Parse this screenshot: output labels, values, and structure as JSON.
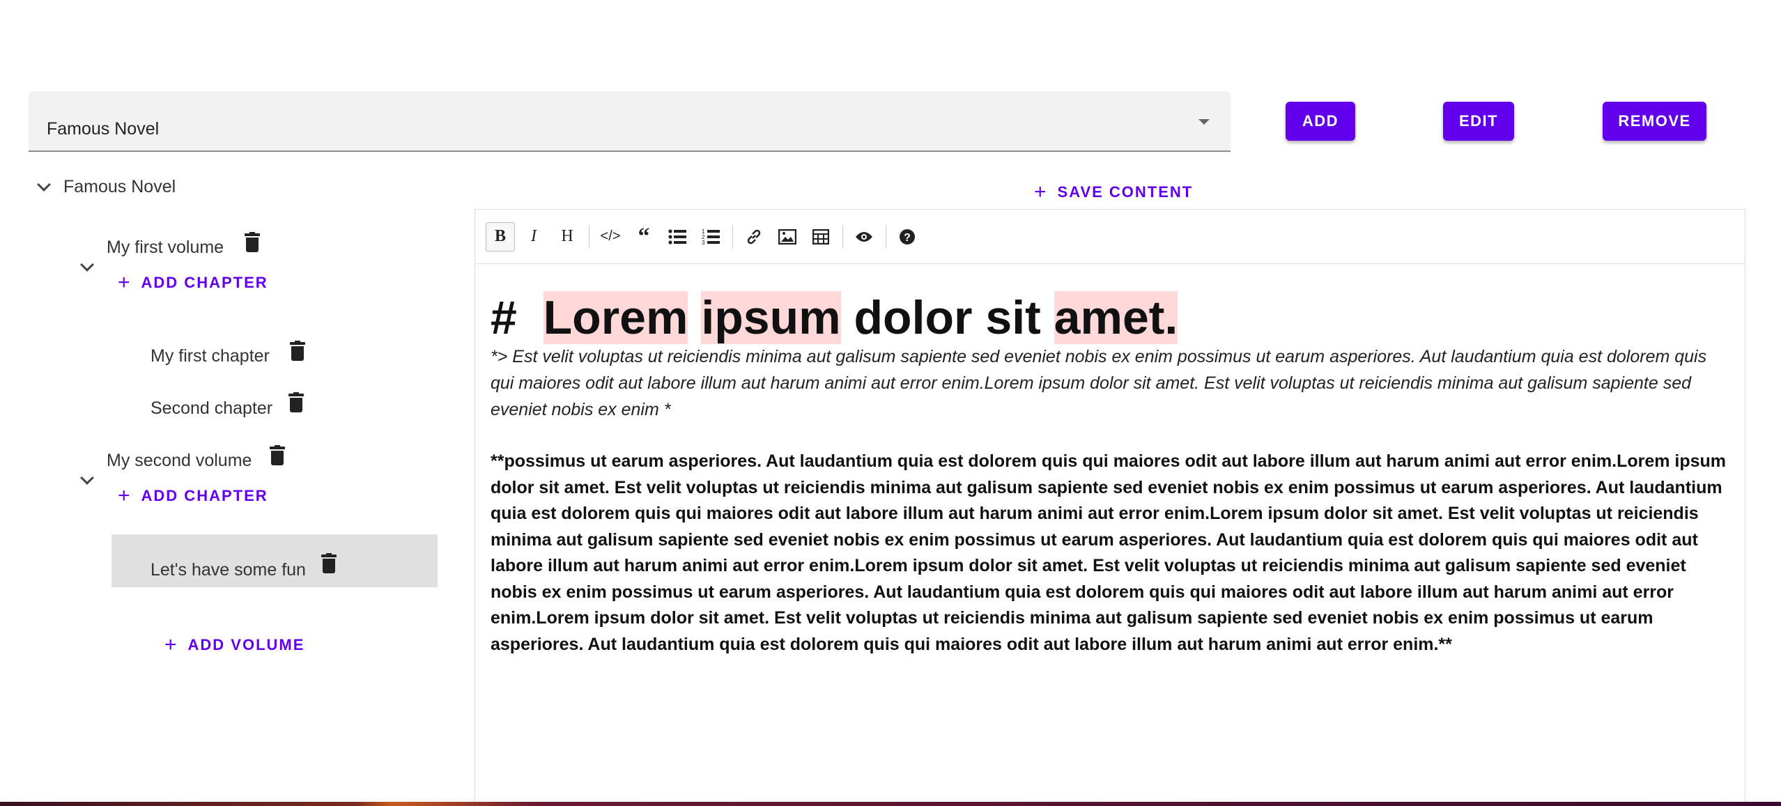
{
  "selector": {
    "value": "Famous Novel"
  },
  "buttons": {
    "add": "ADD",
    "edit": "EDIT",
    "remove": "REMOVE",
    "save_content": "SAVE CONTENT",
    "add_volume": "ADD VOLUME"
  },
  "tree": {
    "root": "Famous Novel",
    "volumes": [
      {
        "title": "My first volume",
        "add_chapter": "ADD CHAPTER",
        "chapters": [
          "My first chapter",
          "Second chapter"
        ]
      },
      {
        "title": "My second volume",
        "add_chapter": "ADD CHAPTER",
        "chapters": [
          "Let's have some fun"
        ]
      }
    ]
  },
  "editor": {
    "toolbar": [
      "bold",
      "italic",
      "heading",
      "code",
      "quote",
      "unordered-list",
      "ordered-list",
      "link",
      "image",
      "table",
      "preview",
      "help"
    ],
    "heading_marker": "#",
    "heading_words": [
      "Lorem",
      "ipsum",
      "dolor",
      "sit",
      "amet."
    ],
    "quote_text": "*> Est velit voluptas ut reiciendis minima aut galisum sapiente sed eveniet nobis ex enim possimus ut earum asperiores. Aut laudantium quia est dolorem quis qui maiores odit aut labore illum aut harum animi aut error enim.Lorem ipsum dolor sit amet. Est velit voluptas ut reiciendis minima aut galisum sapiente sed eveniet nobis ex enim *",
    "bold_text": "**possimus ut earum asperiores. Aut laudantium quia est dolorem quis qui maiores odit aut labore illum aut harum animi aut error enim.Lorem ipsum dolor sit amet. Est velit voluptas ut reiciendis minima aut galisum sapiente sed eveniet nobis ex enim possimus ut earum asperiores. Aut laudantium quia est dolorem quis qui maiores odit aut labore illum aut harum animi aut error enim.Lorem ipsum dolor sit amet. Est velit voluptas ut reiciendis minima aut galisum sapiente sed eveniet nobis ex enim possimus ut earum asperiores. Aut laudantium quia est dolorem quis qui maiores odit aut labore illum aut harum animi aut error enim.Lorem ipsum dolor sit amet. Est velit voluptas ut reiciendis minima aut galisum sapiente sed eveniet nobis ex enim possimus ut earum asperiores. Aut laudantium quia est dolorem quis qui maiores odit aut labore illum aut harum animi aut error enim.Lorem ipsum dolor sit amet. Est velit voluptas ut reiciendis minima aut galisum sapiente sed eveniet nobis ex enim possimus ut earum asperiores. Aut laudantium quia est dolorem quis qui maiores odit aut labore illum aut harum animi aut error enim.**"
  },
  "colors": {
    "accent": "#6200ee",
    "highlight": "#ffd9d9",
    "selected_row": "#e0e0e0"
  }
}
